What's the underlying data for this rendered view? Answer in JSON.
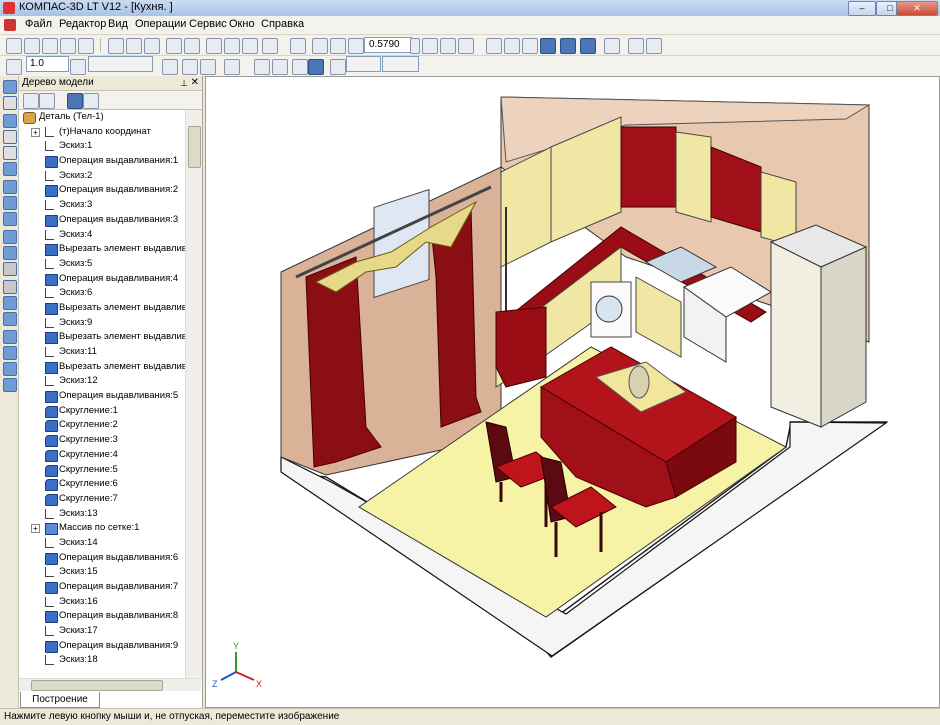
{
  "window": {
    "title": "КОМПАС-3D LT V12 - [Кухня. ]",
    "minimize": "–",
    "maximize": "□",
    "close": "✕"
  },
  "menu": [
    "Файл",
    "Редактор",
    "Вид",
    "Операции",
    "Сервис",
    "Окно",
    "Справка"
  ],
  "toolbar": {
    "zoom_value": "0.5790",
    "step_value": "1.0"
  },
  "model_tree": {
    "title": "Дерево модели",
    "root": "Деталь (Тел-1)",
    "items": [
      {
        "label": "(т)Начало координат",
        "icon": "origin-icon"
      },
      {
        "label": "Эскиз:1",
        "icon": "sketch-icon"
      },
      {
        "label": "Операция выдавливания:1",
        "icon": "extrude-icon"
      },
      {
        "label": "Эскиз:2",
        "icon": "sketch-icon"
      },
      {
        "label": "Операция выдавливания:2",
        "icon": "extrude-icon"
      },
      {
        "label": "Эскиз:3",
        "icon": "sketch-icon"
      },
      {
        "label": "Операция выдавливания:3",
        "icon": "extrude-icon"
      },
      {
        "label": "Эскиз:4",
        "icon": "sketch-icon"
      },
      {
        "label": "Вырезать элемент выдавливан",
        "icon": "cut-icon"
      },
      {
        "label": "Эскиз:5",
        "icon": "sketch-icon"
      },
      {
        "label": "Операция выдавливания:4",
        "icon": "extrude-icon"
      },
      {
        "label": "Эскиз:6",
        "icon": "sketch-icon"
      },
      {
        "label": "Вырезать элемент выдавливан",
        "icon": "cut-icon"
      },
      {
        "label": "Эскиз:9",
        "icon": "sketch-icon"
      },
      {
        "label": "Вырезать элемент выдавливан",
        "icon": "cut-icon"
      },
      {
        "label": "Эскиз:11",
        "icon": "sketch-icon"
      },
      {
        "label": "Вырезать элемент выдавливан",
        "icon": "cut-icon"
      },
      {
        "label": "Эскиз:12",
        "icon": "sketch-icon"
      },
      {
        "label": "Операция выдавливания:5",
        "icon": "extrude-icon"
      },
      {
        "label": "Скругление:1",
        "icon": "fillet-icon"
      },
      {
        "label": "Скругление:2",
        "icon": "fillet-icon"
      },
      {
        "label": "Скругление:3",
        "icon": "fillet-icon"
      },
      {
        "label": "Скругление:4",
        "icon": "fillet-icon"
      },
      {
        "label": "Скругление:5",
        "icon": "fillet-icon"
      },
      {
        "label": "Скругление:6",
        "icon": "fillet-icon"
      },
      {
        "label": "Скругление:7",
        "icon": "fillet-icon"
      },
      {
        "label": "Эскиз:13",
        "icon": "sketch-icon"
      },
      {
        "label": "Массив по сетке:1",
        "icon": "array-icon"
      },
      {
        "label": "Эскиз:14",
        "icon": "sketch-icon"
      },
      {
        "label": "Операция выдавливания:6",
        "icon": "extrude-icon"
      },
      {
        "label": "Эскиз:15",
        "icon": "sketch-icon"
      },
      {
        "label": "Операция выдавливания:7",
        "icon": "extrude-icon"
      },
      {
        "label": "Эскиз:16",
        "icon": "sketch-icon"
      },
      {
        "label": "Операция выдавливания:8",
        "icon": "extrude-icon"
      },
      {
        "label": "Эскиз:17",
        "icon": "sketch-icon"
      },
      {
        "label": "Операция выдавливания:9",
        "icon": "extrude-icon"
      },
      {
        "label": "Эскиз:18",
        "icon": "sketch-icon"
      }
    ],
    "tab_label": "Построение"
  },
  "axes": {
    "x": "X",
    "y": "Y",
    "z": "Z"
  },
  "status_text": "Нажмите левую кнопку мыши и, не отпуская, переместите изображение",
  "colors": {
    "wall": "#e8c9b0",
    "wall_left": "#d9b298",
    "floor": "#ffffff",
    "rug": "#f7f3a6",
    "red": "#b3131b",
    "cream": "#efe7a3"
  }
}
